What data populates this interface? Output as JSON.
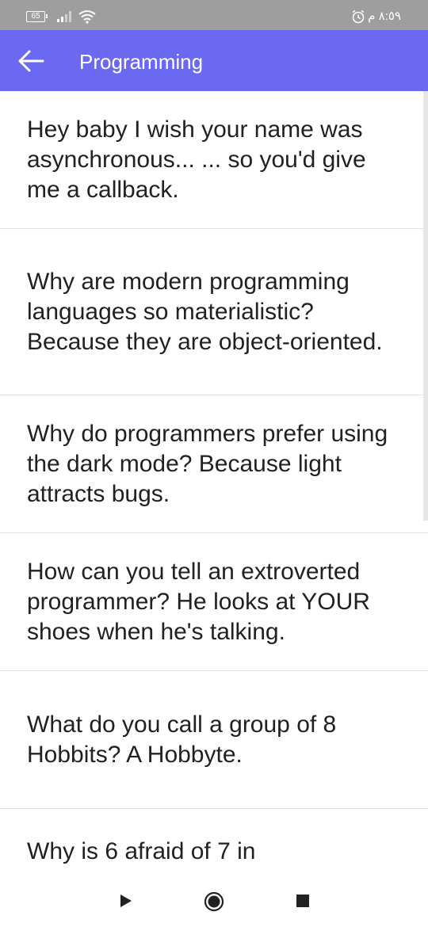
{
  "status_bar": {
    "battery": "65",
    "time": "٨:٥٩ م",
    "icons": [
      "battery-icon",
      "signal-icon",
      "wifi-icon",
      "alarm-icon"
    ]
  },
  "app_bar": {
    "title": "Programming",
    "back_icon": "arrow-left-icon",
    "color": "#6b68f2"
  },
  "jokes": [
    "Hey baby I wish your name was asynchronous... ... so you'd give me a callback.",
    "Why are modern programming languages so materialistic? Because they are object-oriented.",
    "Why do programmers prefer using the dark mode? Because light attracts bugs.",
    "How can you tell an extroverted programmer? He looks at YOUR shoes when he's talking.",
    "What do you call a group of 8 Hobbits? A Hobbyte.",
    "Why is 6 afraid of 7 in"
  ],
  "nav_bar": {
    "icons": [
      "back-triangle-icon",
      "home-circle-icon",
      "recents-square-icon"
    ]
  }
}
